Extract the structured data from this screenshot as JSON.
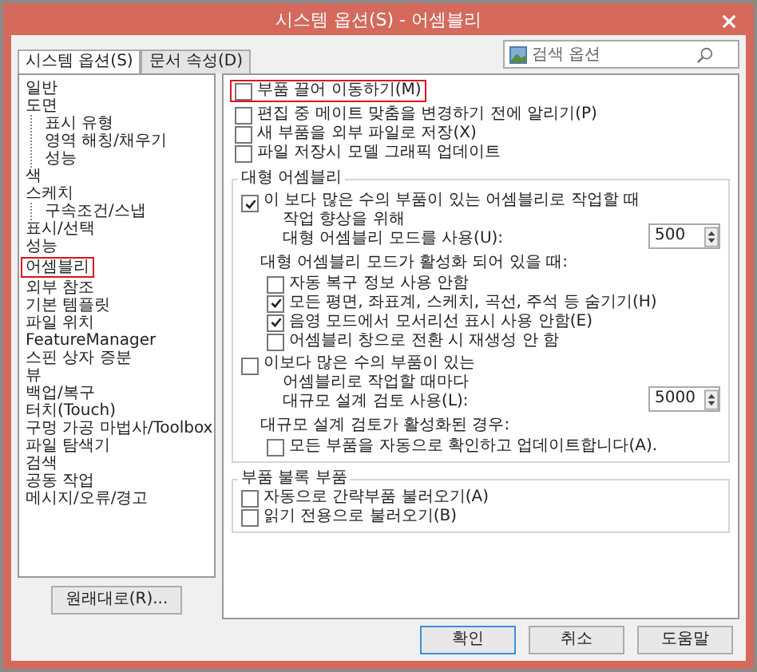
{
  "window": {
    "title": "시스템 옵션(S) - 어셈블리"
  },
  "tabs": [
    {
      "label": "시스템 옵션(S)",
      "selected": true
    },
    {
      "label": "문서 속성(D)",
      "selected": false
    }
  ],
  "search": {
    "placeholder": "검색 옵션"
  },
  "sidebar": {
    "items": [
      {
        "label": "일반",
        "selected": false
      },
      {
        "label": "도면",
        "selected": false,
        "children": [
          {
            "label": "표시 유형",
            "selected": false
          },
          {
            "label": "영역 해칭/채우기",
            "selected": false
          },
          {
            "label": "성능",
            "selected": false
          }
        ]
      },
      {
        "label": "색",
        "selected": false
      },
      {
        "label": "스케치",
        "selected": false,
        "children": [
          {
            "label": "구속조건/스냅",
            "selected": false
          }
        ]
      },
      {
        "label": "표시/선택",
        "selected": false
      },
      {
        "label": "성능",
        "selected": false
      },
      {
        "label": "어셈블리",
        "selected": true
      },
      {
        "label": "외부 참조",
        "selected": false
      },
      {
        "label": "기본 템플릿",
        "selected": false
      },
      {
        "label": "파일 위치",
        "selected": false
      },
      {
        "label": "FeatureManager",
        "selected": false
      },
      {
        "label": "스핀 상자 증분",
        "selected": false
      },
      {
        "label": "뷰",
        "selected": false
      },
      {
        "label": "백업/복구",
        "selected": false
      },
      {
        "label": "터치(Touch)",
        "selected": false
      },
      {
        "label": "구멍 가공 마법사/Toolbox",
        "selected": false
      },
      {
        "label": "파일 탐색기",
        "selected": false
      },
      {
        "label": "검색",
        "selected": false
      },
      {
        "label": "공동 작업",
        "selected": false
      },
      {
        "label": "메시지/오류/경고",
        "selected": false
      }
    ]
  },
  "reset_button": "원래대로(R)...",
  "options": [
    {
      "label": "부품 끌어 이동하기(M)",
      "checked": false,
      "highlighted": true
    },
    {
      "label": "편집 중 메이트 맞춤을 변경하기 전에 알리기(P)",
      "checked": false,
      "highlighted": false
    },
    {
      "label": "새 부품을 외부 파일로 저장(X)",
      "checked": false,
      "highlighted": false
    },
    {
      "label": "파일 저장시 모델 그래픽 업데이트",
      "checked": false,
      "highlighted": false
    }
  ],
  "groups": [
    {
      "title": "대형 어셈블리",
      "items": [
        {
          "kind": "check_spin",
          "lines": [
            "이 보다 많은 수의 부품이 있는 어셈블리로 작업할 때",
            "작업 향상을 위해",
            "대형 어셈블리 모드를 사용(U):"
          ],
          "checked": true,
          "value": "500"
        },
        {
          "kind": "label",
          "text": "대형 어셈블리 모드가 활성화 되어 있을 때:"
        },
        {
          "kind": "subcheck",
          "label": "자동 복구 정보 사용 안함",
          "checked": false
        },
        {
          "kind": "subcheck",
          "label": "모든 평면, 좌표계, 스케치, 곡선, 주석 등 숨기기(H)",
          "checked": true
        },
        {
          "kind": "subcheck",
          "label": "음영 모드에서 모서리선 표시 사용 안함(E)",
          "checked": true
        },
        {
          "kind": "subcheck",
          "label": "어셈블리 창으로 전환 시 재생성 안 함",
          "checked": false
        },
        {
          "kind": "check_spin",
          "lines": [
            "이보다 많은 수의 부품이 있는",
            "어셈블리로 작업할 때마다",
            "대규모 설계 검토 사용(L):"
          ],
          "checked": false,
          "value": "5000"
        },
        {
          "kind": "label",
          "text": "대규모 설계 검토가 활성화된 경우:"
        },
        {
          "kind": "subcheck",
          "label": "모든 부품을 자동으로 확인하고 업데이트합니다(A).",
          "checked": false
        }
      ]
    },
    {
      "title": "부품 불록 부품",
      "items": [
        {
          "kind": "check",
          "label": "자동으로 간략부품 불러오기(A)",
          "checked": false
        },
        {
          "kind": "check",
          "label": "읽기 전용으로 불러오기(B)",
          "checked": false
        }
      ]
    }
  ],
  "buttons": [
    "확인",
    "취소",
    "도움말"
  ]
}
